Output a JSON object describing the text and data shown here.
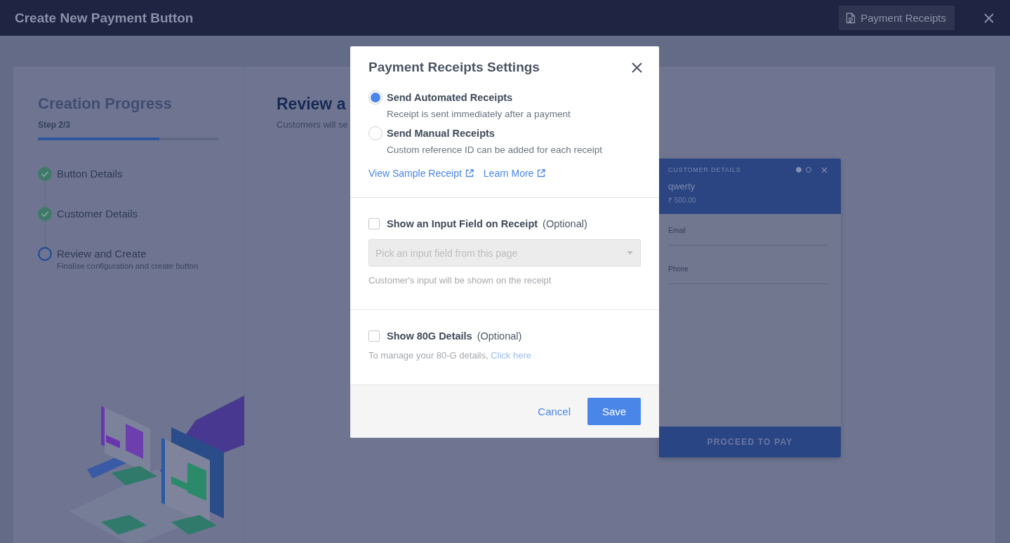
{
  "header": {
    "title": "Create New Payment Button",
    "receipts_button": "Payment Receipts"
  },
  "progress": {
    "title": "Creation Progress",
    "step": "Step 2/3",
    "level": 0.67,
    "steps": [
      {
        "label": "Button Details",
        "completed": true
      },
      {
        "label": "Customer Details",
        "completed": true
      },
      {
        "label": "Review and Create",
        "completed": false,
        "description": "Finalise configuration and create button"
      }
    ]
  },
  "review": {
    "title": "Review a",
    "subtitle": "Customers will se"
  },
  "preview": {
    "heading": "CUSTOMER DETAILS",
    "page_dots": [
      {
        "selected": true
      },
      {
        "selected": false
      }
    ],
    "name": "qwerty",
    "amount": "₹ 500.00",
    "fields": [
      {
        "label": "Email"
      },
      {
        "label": "Phone"
      }
    ],
    "pay_button": "PROCEED TO PAY"
  },
  "modal": {
    "title": "Payment Receipts Settings",
    "options": [
      {
        "label": "Send Automated Receipts",
        "description": "Receipt is sent immediately after a payment",
        "selected": true
      },
      {
        "label": "Send Manual Receipts",
        "description": "Custom reference ID can be added for each receipt",
        "selected": false
      }
    ],
    "links": [
      "View Sample Receipt",
      "Learn More"
    ],
    "input_field": {
      "label": "Show an Input Field on Receipt",
      "optional": "(Optional)",
      "checked": false,
      "placeholder": "Pick an input field from this page",
      "hint": "Customer's input will be shown on the receipt"
    },
    "details_80g": {
      "label": "Show 80G Details",
      "optional": "(Optional)",
      "checked": false,
      "note": "To manage your 80-G details, ",
      "link": "Click here"
    },
    "cancel": "Cancel",
    "save": "Save"
  }
}
